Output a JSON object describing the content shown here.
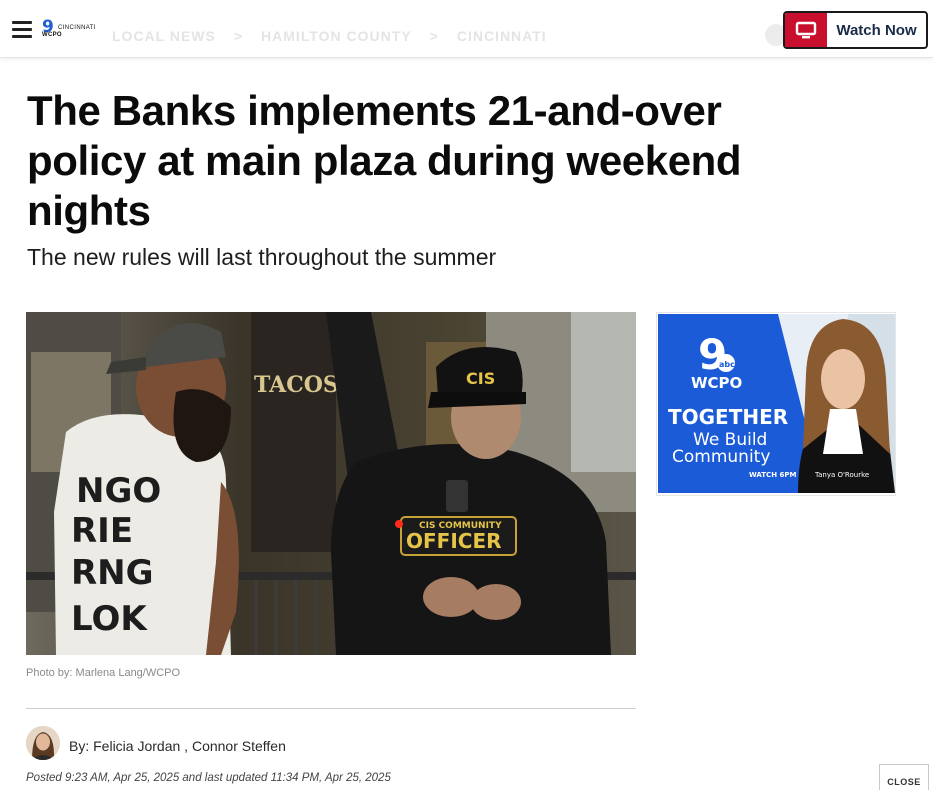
{
  "header": {
    "logo_brand": "WCPO",
    "logo_city": "CINCINNATI",
    "logo_number": "9",
    "breadcrumbs": [
      "LOCAL NEWS",
      ">",
      "HAMILTON COUNTY",
      ">",
      "CINCINNATI"
    ],
    "watch_label": "Watch Now",
    "accent_color": "#c8102e"
  },
  "article": {
    "headline": "The Banks implements 21-and-over policy at main plaza during weekend nights",
    "subheadline": "The new rules will last throughout the summer",
    "photo_credit": "Photo by: Marlena Lang/WCPO",
    "byline_prefix": "By:",
    "authors": [
      "Felicia Jordan",
      "Connor Steffen"
    ],
    "author_separator": ",",
    "posted": "Posted 9:23 AM, Apr 25, 2025 and last updated 11:34 PM, Apr 25, 2025"
  },
  "photo_scene": {
    "cap_text": "CIS",
    "patch_top": "CIS COMMUNITY",
    "patch_main": "OFFICER",
    "sign_text": "TACOS",
    "shirt_text": [
      "NGO",
      "RIE",
      "RNG",
      "LOK"
    ]
  },
  "ad": {
    "channel_number": "9",
    "channel_sub": "abc",
    "brand": "WCPO",
    "line1": "TOGETHER",
    "line2": "We Build",
    "line3": "Community",
    "time": "WATCH 6PM",
    "anchor": "Tanya O'Rourke",
    "bg_color": "#1b5bd8"
  },
  "close_label": "CLOSE"
}
